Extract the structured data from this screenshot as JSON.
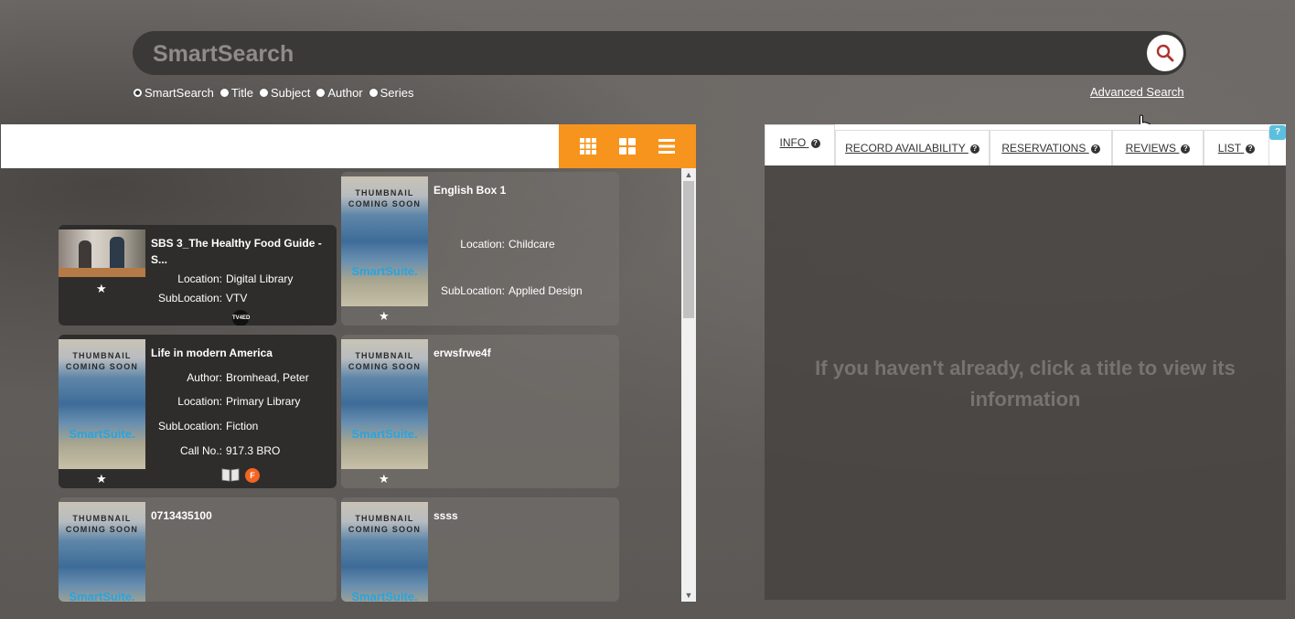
{
  "search": {
    "placeholder": "SmartSearch"
  },
  "search_types": [
    {
      "label": "SmartSearch",
      "selected": true
    },
    {
      "label": "Title",
      "selected": false
    },
    {
      "label": "Subject",
      "selected": false
    },
    {
      "label": "Author",
      "selected": false
    },
    {
      "label": "Series",
      "selected": false
    }
  ],
  "advanced_search_label": "Advanced Search",
  "thumbnail_text": {
    "line1": "THUMBNAIL",
    "line2": "COMING SOON",
    "brand": "SmartSuite."
  },
  "results": [
    {
      "title": "English Box 1",
      "fields": [
        {
          "label": "Location:",
          "value": "Childcare"
        },
        {
          "label": "SubLocation:",
          "value": "Applied Design"
        }
      ]
    },
    {
      "title": "SBS 3_The Healthy Food Guide - S...",
      "fields": [
        {
          "label": "Location:",
          "value": "Digital Library"
        },
        {
          "label": "SubLocation:",
          "value": "VTV"
        }
      ],
      "badge": "TV4ED"
    },
    {
      "title": "Life in modern America",
      "fields": [
        {
          "label": "Author:",
          "value": "Bromhead, Peter"
        },
        {
          "label": "Location:",
          "value": "Primary Library"
        },
        {
          "label": "SubLocation:",
          "value": "Fiction"
        },
        {
          "label": "Call No.:",
          "value": "917.3 BRO"
        }
      ],
      "badge": "F"
    },
    {
      "title": "erwsfrwe4f",
      "fields": []
    },
    {
      "title": "0713435100",
      "fields": []
    },
    {
      "title": "ssss",
      "fields": []
    }
  ],
  "tabs": [
    {
      "label": "INFO",
      "active": true
    },
    {
      "label": "RECORD AVAILABILITY",
      "active": false
    },
    {
      "label": "RESERVATIONS",
      "active": false
    },
    {
      "label": "REVIEWS",
      "active": false
    },
    {
      "label": "LIST",
      "active": false
    }
  ],
  "help_icon": "?",
  "info_message": "If you haven't already, click a title to view its information",
  "colors": {
    "accent": "#f7941d",
    "brand_blue": "#29a4e0",
    "badge_orange": "#f26522"
  }
}
